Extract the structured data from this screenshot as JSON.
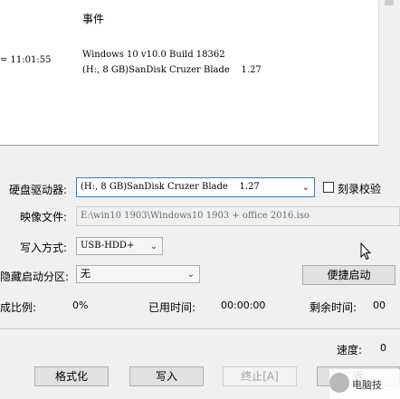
{
  "log": {
    "header": "事件",
    "rows": [
      {
        "time": "",
        "message": "Windows 10 v10.0 Build 18362"
      },
      {
        "time": "= 11:01:55",
        "message": "(H:, 8 GB)SanDisk Cruzer Blade    1.27"
      }
    ]
  },
  "form": {
    "drive_label": "硬盘驱动器:",
    "drive_value": "(H:, 8 GB)SanDisk Cruzer Blade    1.27",
    "verify_label": "刻录校验",
    "image_label": "映像文件:",
    "image_value": "E:\\win10 1903\\Windows10 1903 + office 2016.iso",
    "write_method_label": "写入方式:",
    "write_method_value": "USB-HDD+",
    "hidden_partition_label": "隐藏启动分区:",
    "hidden_partition_value": "无",
    "quick_boot_button": "便捷启动"
  },
  "progress": {
    "ratio_label": "成比例:",
    "ratio_value": "0%",
    "elapsed_label": "已用时间:",
    "elapsed_value": "00:00:00",
    "remaining_label": "剩余时间:",
    "remaining_value": "00",
    "speed_label": "速度:",
    "speed_value": "0"
  },
  "buttons": {
    "format": "格式化",
    "write": "写入",
    "stop": "终止[A]",
    "extra": "返"
  },
  "watermark": {
    "text": "电脑技"
  }
}
